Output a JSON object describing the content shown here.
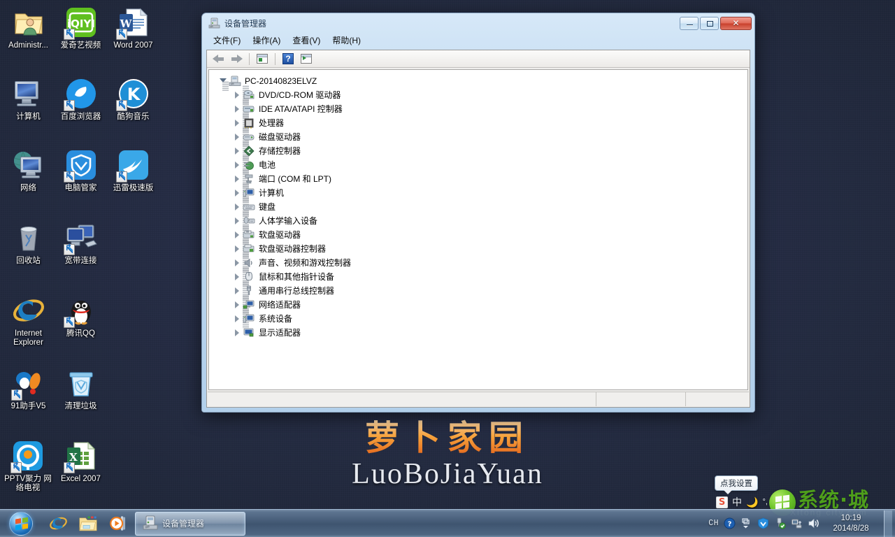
{
  "desktop": {
    "background_color": "#242c44",
    "wallpaper": {
      "logo_cn": "萝卜家园",
      "logo_en": "LuoBoJiaYuan",
      "logo_color": "#f0922c"
    },
    "icons": [
      {
        "label": "Administr...",
        "icon": "user-folder-icon",
        "shortcut": false
      },
      {
        "label": "爱奇艺视频",
        "icon": "iqiyi-icon",
        "shortcut": true
      },
      {
        "label": "Word 2007",
        "icon": "word-icon",
        "shortcut": true
      },
      {
        "label": "计算机",
        "icon": "computer-icon",
        "shortcut": false
      },
      {
        "label": "百度浏览器",
        "icon": "baidu-browser-icon",
        "shortcut": true
      },
      {
        "label": "酷狗音乐",
        "icon": "kugou-music-icon",
        "shortcut": true
      },
      {
        "label": "网络",
        "icon": "network-icon",
        "shortcut": false
      },
      {
        "label": "电脑管家",
        "icon": "pc-manager-shield-icon",
        "shortcut": true
      },
      {
        "label": "迅雷极速版",
        "icon": "thunder-xunlei-icon",
        "shortcut": true
      },
      {
        "label": "回收站",
        "icon": "recycle-bin-icon",
        "shortcut": false
      },
      {
        "label": "宽带连接",
        "icon": "broadband-connection-icon",
        "shortcut": true
      },
      {
        "label": "Internet\nExplorer",
        "icon": "internet-explorer-icon",
        "shortcut": false
      },
      {
        "label": "腾讯QQ",
        "icon": "tencent-qq-penguin-icon",
        "shortcut": true
      },
      {
        "label": "91助手V5",
        "icon": "assistant91-icon",
        "shortcut": true
      },
      {
        "label": "清理垃圾",
        "icon": "clean-trash-icon",
        "shortcut": false
      },
      {
        "label": "PPTV聚力 网\n络电视",
        "icon": "pptv-icon",
        "shortcut": true
      },
      {
        "label": "Excel 2007",
        "icon": "excel-icon",
        "shortcut": true
      }
    ]
  },
  "window": {
    "title": "设备管理器",
    "title_icon": "device-manager-icon",
    "buttons": {
      "minimize": "最小化",
      "maximize": "最大化",
      "close": "关闭"
    },
    "menu": [
      {
        "label": "文件(F)"
      },
      {
        "label": "操作(A)"
      },
      {
        "label": "查看(V)"
      },
      {
        "label": "帮助(H)"
      }
    ],
    "toolbar": [
      {
        "name": "back-button",
        "icon": "arrow-left-icon"
      },
      {
        "name": "forward-button",
        "icon": "arrow-right-icon"
      },
      {
        "name": "show-hide-console-tree-button",
        "icon": "console-tree-icon"
      },
      {
        "name": "help-button",
        "icon": "question-mark-icon"
      },
      {
        "name": "properties-button",
        "icon": "properties-pane-icon"
      }
    ],
    "tree": {
      "root": {
        "label": "PC-20140823ELVZ",
        "icon": "computer-node-icon",
        "expanded": true
      },
      "children": [
        {
          "label": "DVD/CD-ROM 驱动器",
          "icon": "dvd-drive-icon"
        },
        {
          "label": "IDE ATA/ATAPI 控制器",
          "icon": "ide-controller-icon"
        },
        {
          "label": "处理器",
          "icon": "processor-icon"
        },
        {
          "label": "磁盘驱动器",
          "icon": "disk-drive-icon"
        },
        {
          "label": "存储控制器",
          "icon": "storage-controller-icon"
        },
        {
          "label": "电池",
          "icon": "battery-icon"
        },
        {
          "label": "端口 (COM 和 LPT)",
          "icon": "ports-icon"
        },
        {
          "label": "计算机",
          "icon": "computer-icon"
        },
        {
          "label": "键盘",
          "icon": "keyboard-icon"
        },
        {
          "label": "人体学输入设备",
          "icon": "hid-icon"
        },
        {
          "label": "软盘驱动器",
          "icon": "floppy-drive-icon"
        },
        {
          "label": "软盘驱动器控制器",
          "icon": "floppy-controller-icon"
        },
        {
          "label": "声音、视频和游戏控制器",
          "icon": "sound-video-game-icon"
        },
        {
          "label": "鼠标和其他指针设备",
          "icon": "mouse-icon"
        },
        {
          "label": "通用串行总线控制器",
          "icon": "usb-controller-icon"
        },
        {
          "label": "网络适配器",
          "icon": "network-adapter-icon"
        },
        {
          "label": "系统设备",
          "icon": "system-device-icon"
        },
        {
          "label": "显示适配器",
          "icon": "display-adapter-icon"
        }
      ]
    },
    "statusbar": {
      "pane1": "",
      "pane2": "",
      "pane3": ""
    }
  },
  "ime": {
    "tooltip": "点我设置",
    "logo": "S",
    "mode": "中",
    "icons": [
      "moon-icon",
      "keyboard-toolbox-icon"
    ]
  },
  "site_watermark": {
    "text": "系统·城",
    "subtext": "Xitong city.com"
  },
  "taskbar": {
    "start_label": "开始",
    "quicklaunch": [
      {
        "name": "internet-explorer",
        "icon": "internet-explorer-icon"
      },
      {
        "name": "windows-explorer",
        "icon": "folder-icon"
      },
      {
        "name": "media-player",
        "icon": "media-player-icon"
      }
    ],
    "tasks": [
      {
        "label": "设备管理器",
        "icon": "device-manager-icon",
        "active": true
      }
    ],
    "tray": {
      "language": "CH",
      "icons": [
        {
          "name": "action-center-icon"
        },
        {
          "name": "show-hidden-icons-icon"
        },
        {
          "name": "pc-manager-shield-icon"
        },
        {
          "name": "safely-remove-hardware-icon"
        },
        {
          "name": "network-icon"
        },
        {
          "name": "volume-icon"
        }
      ],
      "clock_time": "10:19",
      "clock_date": "2014/8/28"
    }
  }
}
